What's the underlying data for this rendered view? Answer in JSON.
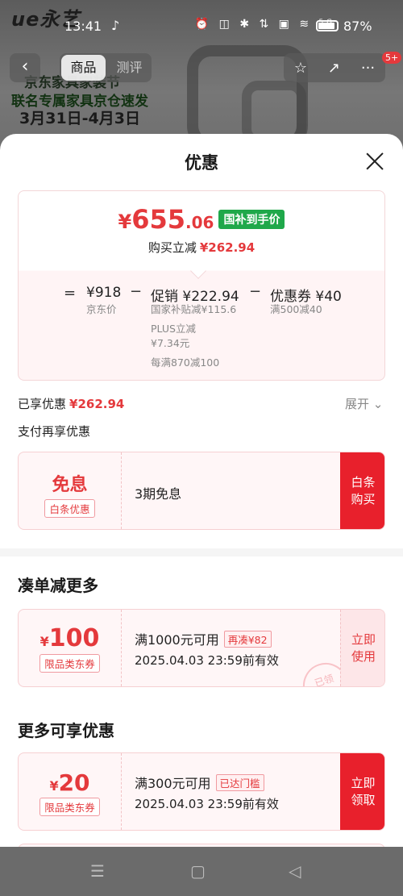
{
  "status": {
    "time": "13:41",
    "app_icon": "♪",
    "icons": "⏰ ◫ ✱ ⇅ ▣ ≋ ⁵ᴳ",
    "battery": "87%"
  },
  "bg": {
    "brand": "ue永艺",
    "banner1": "京东家具家装节",
    "banner2": "联名专属家具京仓速发",
    "banner3": "3月31日-4月3日"
  },
  "nav": {
    "back": "‹",
    "tabs": [
      "商品",
      "测评"
    ],
    "star": "☆",
    "share": "↗",
    "more": "···",
    "badge": "5+"
  },
  "sheet": {
    "title": "优惠"
  },
  "price": {
    "yen": "¥",
    "int": "655",
    "dec": ".06",
    "tag": "国补到手价",
    "reduce_label": "购买立减",
    "reduce_value": "¥262.94"
  },
  "calc": {
    "eq": "=",
    "minus1": "−",
    "minus2": "−",
    "jd_price": "¥918",
    "jd_label": "京东价",
    "promo_main": "促销 ¥222.94",
    "promo_sub1": "国家补贴减¥115.6",
    "promo_sub2": "PLUS立减",
    "promo_sub3": "¥7.34元",
    "promo_sub4": "每满870减100",
    "coupon_main": "优惠券 ¥40",
    "coupon_sub": "满500减40"
  },
  "enjoyed": {
    "label": "已享优惠",
    "value": "¥262.94",
    "expand": "展开 ⌄"
  },
  "pay": {
    "title": "支付再享优惠",
    "card": {
      "big": "免息",
      "tag": "白条优惠",
      "desc": "3期免息",
      "btn": "白条\n购买",
      "btn1": "白条",
      "btn2": "购买"
    }
  },
  "more_section": {
    "title": "凑单减更多",
    "coupon": {
      "yen": "¥",
      "amount": "100",
      "tag": "限品类东券",
      "cond": "满1000元可用",
      "extra": "再凑¥82",
      "valid": "2025.04.03 23:59前有效",
      "btn1": "立即",
      "btn2": "使用",
      "stamp": "已领"
    }
  },
  "extra_section": {
    "title": "更多可享优惠",
    "coupon": {
      "yen": "¥",
      "amount": "20",
      "tag": "限品类东券",
      "cond": "满300元可用",
      "extra": "已达门槛",
      "valid": "2025.04.03 23:59前有效",
      "btn1": "立即",
      "btn2": "领取"
    }
  },
  "bottom_nav": {
    "menu": "☰",
    "home": "▢",
    "back": "◁"
  },
  "colors": {
    "accent": "#e4393c",
    "green_tag": "#1fa84a"
  }
}
